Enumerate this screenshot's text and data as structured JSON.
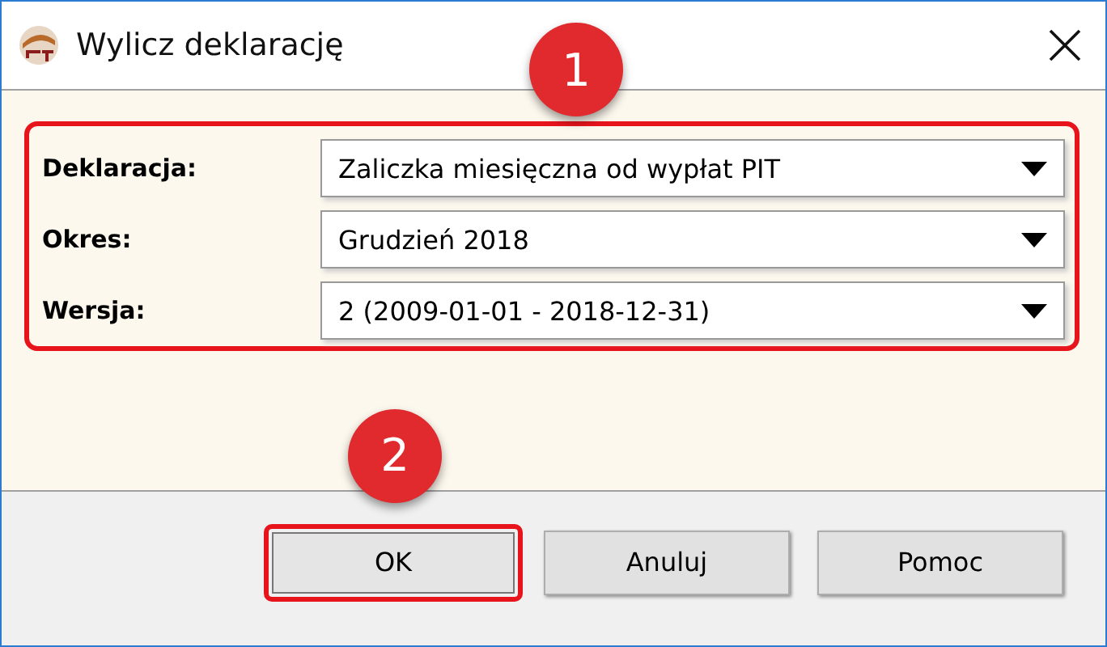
{
  "window": {
    "title": "Wylicz deklarację"
  },
  "form": {
    "highlighted": true,
    "badge": "1",
    "fields": [
      {
        "label": "Deklaracja:",
        "value": "Zaliczka miesięczna od wypłat PIT"
      },
      {
        "label": "Okres:",
        "value": "Grudzień 2018"
      },
      {
        "label": "Wersja:",
        "value": "2 (2009-01-01 - 2018-12-31)"
      }
    ]
  },
  "buttons": [
    {
      "label": "OK",
      "highlighted": true,
      "badge": "2"
    },
    {
      "label": "Anuluj",
      "highlighted": false
    },
    {
      "label": "Pomoc",
      "highlighted": false
    }
  ]
}
